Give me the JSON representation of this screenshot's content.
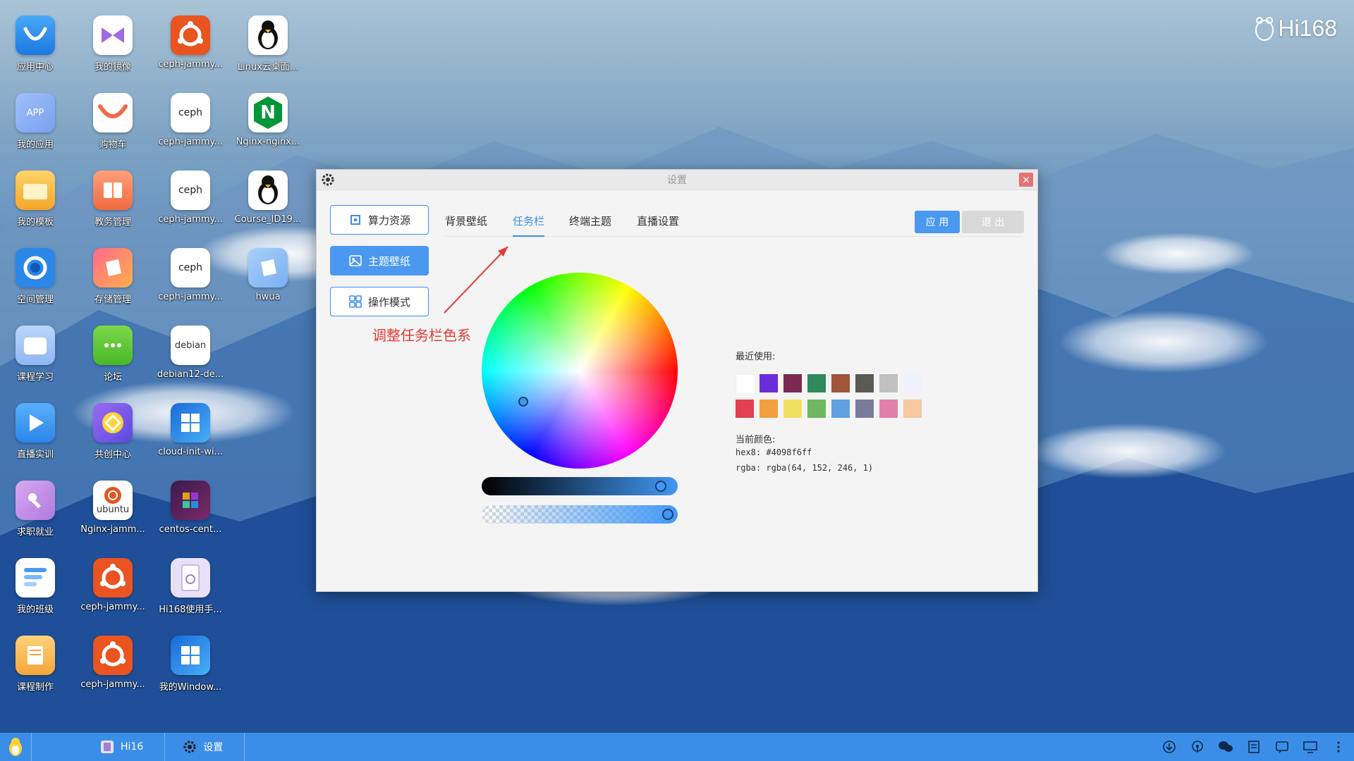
{
  "brand": "Hi168",
  "desktop": {
    "icons": [
      {
        "label": "应用中心",
        "icon": "app-store-icon"
      },
      {
        "label": "我的应用",
        "icon": "my-apps-icon"
      },
      {
        "label": "我的模板",
        "icon": "folder-icon"
      },
      {
        "label": "空间管理",
        "icon": "space-icon"
      },
      {
        "label": "课程学习",
        "icon": "course-icon"
      },
      {
        "label": "直播实训",
        "icon": "live-icon"
      },
      {
        "label": "求职就业",
        "icon": "job-icon"
      },
      {
        "label": "我的班级",
        "icon": "class-icon"
      },
      {
        "label": "课程制作",
        "icon": "course-make-icon"
      },
      {
        "label": "我的镜像",
        "icon": "mirror-icon"
      },
      {
        "label": "购物车",
        "icon": "cart-icon"
      },
      {
        "label": "教务管理",
        "icon": "edu-icon"
      },
      {
        "label": "存储管理",
        "icon": "storage-icon"
      },
      {
        "label": "论坛",
        "icon": "forum-icon"
      },
      {
        "label": "共创中心",
        "icon": "cocreate-icon"
      },
      {
        "label": "Nginx-jamm...",
        "icon": "ubuntu-icon"
      },
      {
        "label": "ceph-jammy...",
        "icon": "ubuntu-icon"
      },
      {
        "label": "ceph-jammy...",
        "icon": "ubuntu-icon"
      },
      {
        "label": "ceph-jammy...",
        "icon": "ubuntu-icon"
      },
      {
        "label": "ceph-jammy...",
        "icon": "ceph-icon"
      },
      {
        "label": "ceph-jammy...",
        "icon": "ceph-icon"
      },
      {
        "label": "ceph-jammy...",
        "icon": "ceph-icon"
      },
      {
        "label": "debian12-de...",
        "icon": "debian-icon"
      },
      {
        "label": "cloud-init-wi...",
        "icon": "windows-icon"
      },
      {
        "label": "centos-cent...",
        "icon": "centos-icon"
      },
      {
        "label": "Hi168使用手...",
        "icon": "manual-icon"
      },
      {
        "label": "我的Window...",
        "icon": "windows-icon"
      },
      {
        "label": "Linux云桌面...",
        "icon": "linux-icon"
      },
      {
        "label": "Nginx-nginx...",
        "icon": "nginx-icon"
      },
      {
        "label": "Course_ID19...",
        "icon": "linux-icon"
      },
      {
        "label": "hwua",
        "icon": "hwua-icon"
      }
    ],
    "tile_texts": {
      "app": "APP",
      "ceph": "ceph",
      "debian": "debian",
      "ubuntu": "ubuntu",
      "nginx": "N"
    }
  },
  "window": {
    "title": "设置",
    "side_buttons": [
      {
        "label": "算力资源",
        "icon": "chip-icon"
      },
      {
        "label": "主题壁纸",
        "icon": "image-icon"
      },
      {
        "label": "操作模式",
        "icon": "grid-icon"
      }
    ],
    "tabs": [
      "背景壁纸",
      "任务栏",
      "终端主题",
      "直播设置"
    ],
    "active_tab": "任务栏",
    "apply_label": "应 用",
    "exit_label": "退 出",
    "color_picker": {
      "recent_label": "最近使用:",
      "recent_colors": [
        "#ffffff",
        "#6c2bd9",
        "#7a2a4e",
        "#2f8a5a",
        "#a0553a",
        "#5a5a55",
        "#c0c0c0",
        "#eef2ff",
        "#e04050",
        "#f0a040",
        "#f0e060",
        "#70b860",
        "#60a0e0",
        "#7a7a9a",
        "#e080a8",
        "#f8c8a0"
      ],
      "current_label": "当前颜色:",
      "hex8_line": "hex8: #4098f6ff",
      "rgba_line": "rgba: rgba(64, 152, 246, 1)",
      "current_color": "#4098f6"
    }
  },
  "annotation": "调整任务栏色系",
  "taskbar": {
    "items": [
      {
        "label": "Hi16",
        "icon": "hi16-app-icon"
      },
      {
        "label": "设置",
        "icon": "gear-icon"
      }
    ],
    "tray": [
      "download-icon",
      "podcast-icon",
      "wechat-icon",
      "notes-icon",
      "chat-icon",
      "monitor-icon",
      "more-icon"
    ]
  }
}
